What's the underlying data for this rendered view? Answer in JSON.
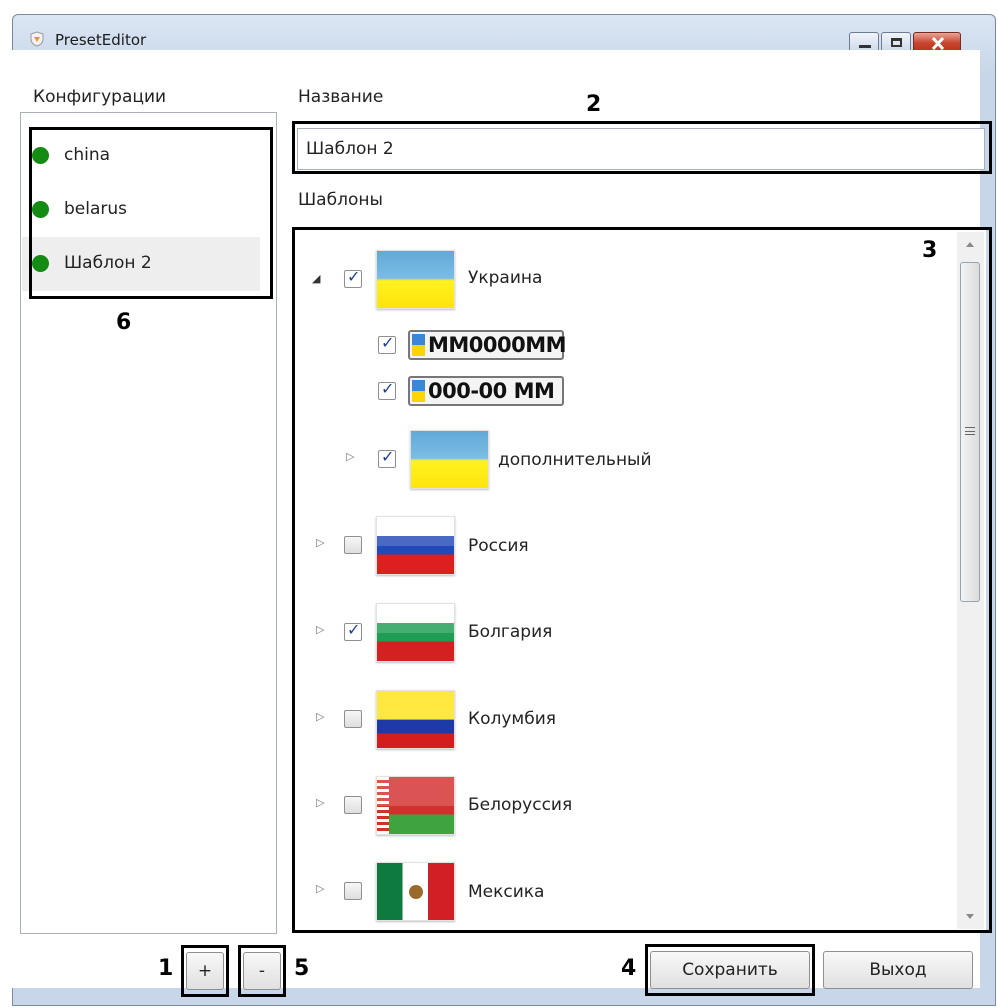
{
  "window": {
    "title": "PresetEditor",
    "icon": "shield-icon"
  },
  "left": {
    "heading": "Конфигурации",
    "configs": [
      {
        "label": "china",
        "status_color": "#148c14"
      },
      {
        "label": "belarus",
        "status_color": "#148c14"
      },
      {
        "label": "Шаблон 2",
        "status_color": "#148c14",
        "selected": true
      }
    ]
  },
  "right": {
    "name_heading": "Название",
    "name_value": "Шаблон 2",
    "templates_heading": "Шаблоны"
  },
  "tree": [
    {
      "label": "Украина",
      "checked": true,
      "expanded": true,
      "flag": "ua",
      "children": [
        {
          "plate": "MM0000MM",
          "checked": true
        },
        {
          "plate": "000-00 MM",
          "checked": true
        },
        {
          "label": "дополнительный",
          "checked": true,
          "expanded": false,
          "flag": "ua"
        }
      ]
    },
    {
      "label": "Россия",
      "checked": false,
      "flag": "ru"
    },
    {
      "label": "Болгария",
      "checked": true,
      "flag": "bg"
    },
    {
      "label": "Колумбия",
      "checked": false,
      "flag": "co"
    },
    {
      "label": "Белоруссия",
      "checked": false,
      "flag": "by"
    },
    {
      "label": "Мексика",
      "checked": false,
      "flag": "mx"
    }
  ],
  "buttons": {
    "add": "+",
    "remove": "-",
    "save": "Сохранить",
    "exit": "Выход"
  },
  "callouts": {
    "n1": "1",
    "n2": "2",
    "n3": "3",
    "n4": "4",
    "n5": "5",
    "n6": "6"
  }
}
